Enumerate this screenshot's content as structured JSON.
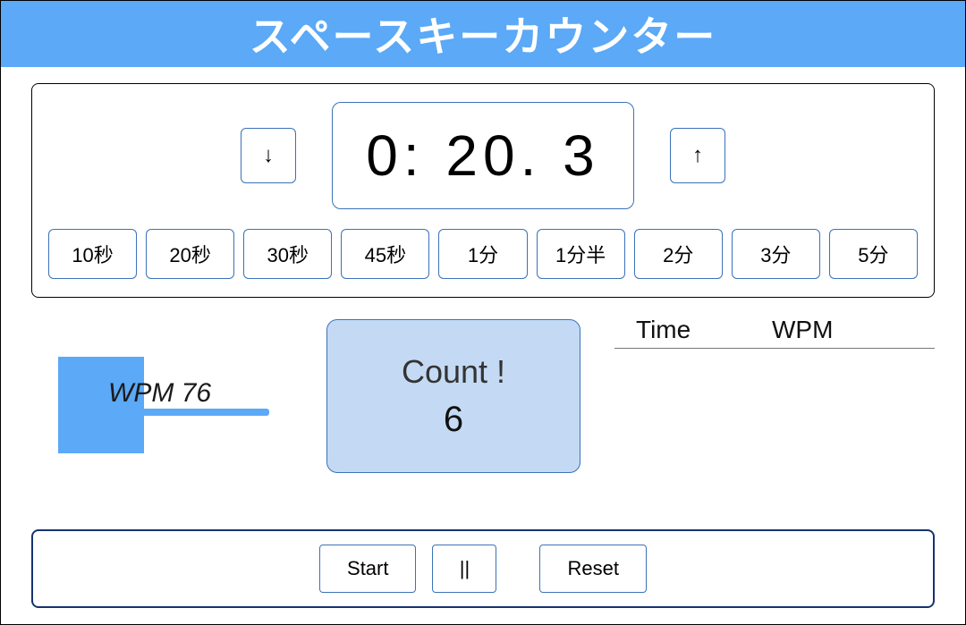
{
  "title": "スペースキーカウンター",
  "timer": {
    "display": "0: 20. 3",
    "down_label": "↓",
    "up_label": "↑"
  },
  "presets": [
    {
      "label": "10秒"
    },
    {
      "label": "20秒"
    },
    {
      "label": "30秒"
    },
    {
      "label": "45秒"
    },
    {
      "label": "1分"
    },
    {
      "label": "1分半"
    },
    {
      "label": "2分"
    },
    {
      "label": "3分"
    },
    {
      "label": "5分"
    }
  ],
  "wpm": {
    "label": "WPM 76",
    "value": 76
  },
  "count": {
    "title": "Count !",
    "value": "6"
  },
  "history": {
    "col_time": "Time",
    "col_wpm": "WPM"
  },
  "controls": {
    "start": "Start",
    "pause": "||",
    "reset": "Reset"
  },
  "colors": {
    "accent": "#5ba9f7",
    "border": "#3b72b8",
    "count_bg": "#c4daf4",
    "controls_border": "#16336f"
  }
}
